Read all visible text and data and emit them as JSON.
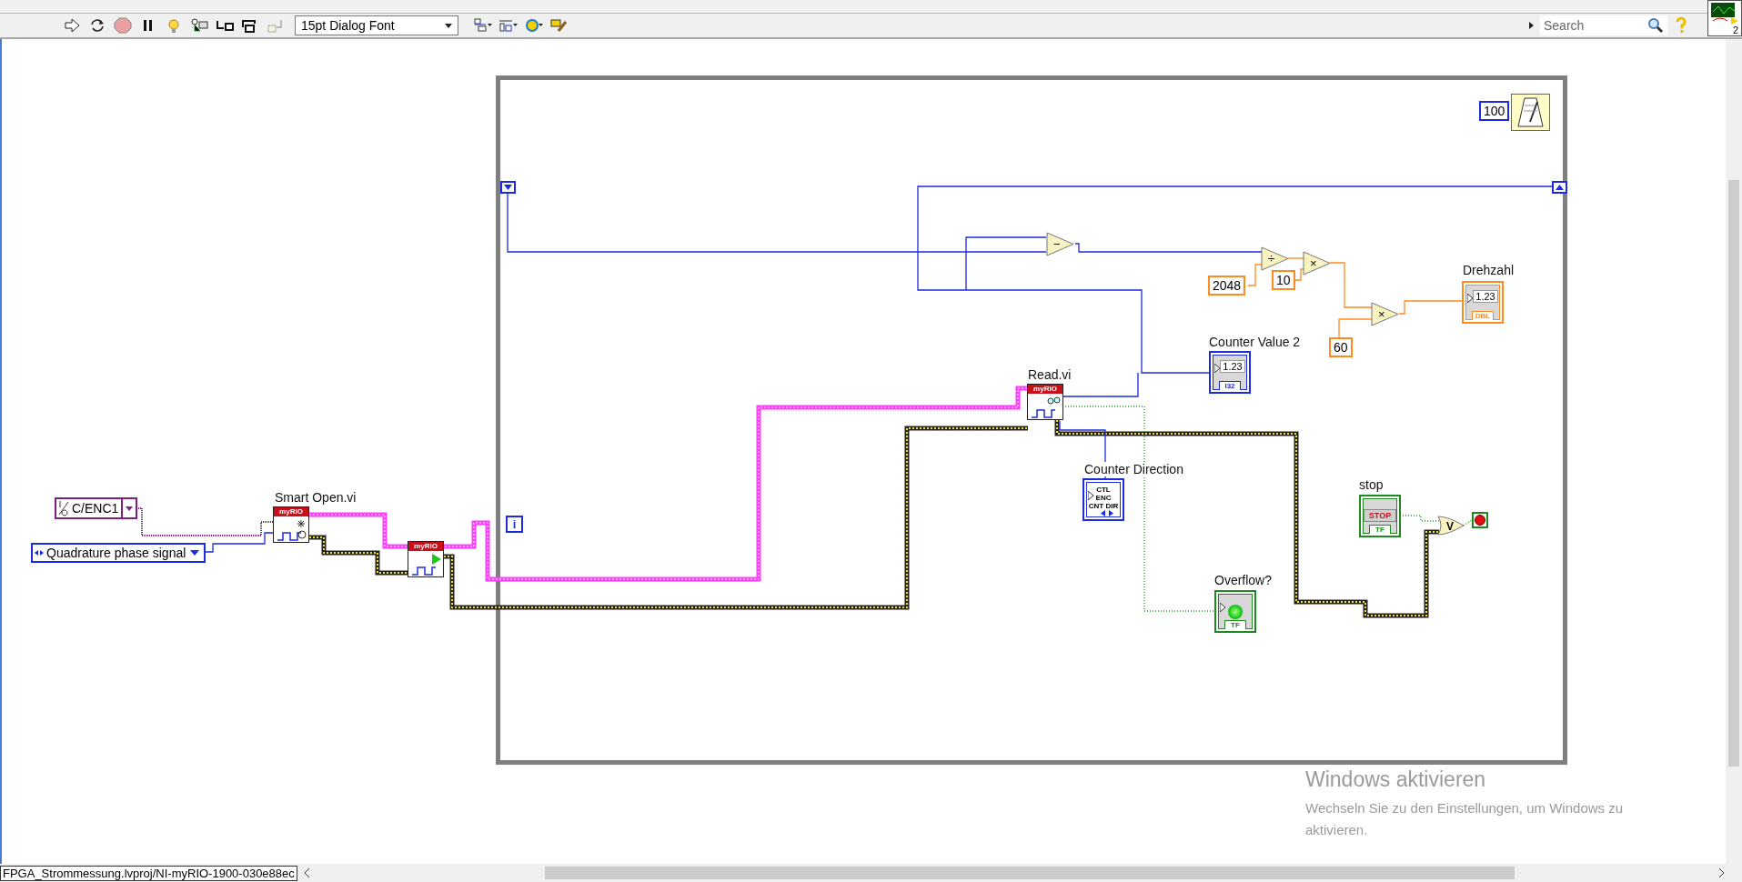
{
  "toolbar": {
    "font_menu": "15pt Dialog Font",
    "search": {
      "placeholder": "Search"
    }
  },
  "vi_icon": {
    "badge": "2"
  },
  "diagram": {
    "inputs": [
      {
        "kind": "io",
        "text": "C/ENC1"
      },
      {
        "kind": "ring",
        "text": "Quadrature phase signal"
      }
    ],
    "subvis": [
      {
        "label": "Smart Open.vi",
        "header": "myRIO",
        "kind": "open"
      },
      {
        "header": "myRIO",
        "kind": "start"
      },
      {
        "label": "Read.vi",
        "header": "myRIO",
        "kind": "read"
      }
    ],
    "while_loop": {
      "iteration": "i",
      "wait_ms": "100"
    },
    "operators": [
      {
        "kind": "subtract",
        "symbol": "−"
      },
      {
        "kind": "divide",
        "symbol": "÷"
      },
      {
        "kind": "multiply",
        "symbol": "×"
      },
      {
        "kind": "multiply",
        "symbol": "×"
      },
      {
        "kind": "or",
        "symbol": "V"
      }
    ],
    "constants": [
      "2048",
      "10",
      "60"
    ],
    "indicators": [
      {
        "kind": "numeric",
        "label": "Counter Value 2",
        "value": "1.23",
        "type": "I32",
        "color": "#1f2bd8"
      },
      {
        "kind": "numeric",
        "label": "Drehzahl",
        "value": "1.23",
        "type": "DBL",
        "color": "#ff8a1f"
      },
      {
        "kind": "enum",
        "label": "Counter Direction",
        "lines": [
          "CTL",
          "ENC",
          "CNT DIR"
        ]
      },
      {
        "kind": "led",
        "label": "Overflow?",
        "type": "TF",
        "on": true
      },
      {
        "kind": "button",
        "label": "stop",
        "text": "STOP",
        "type": "TF"
      }
    ]
  },
  "status_bar": {
    "path": "FPGA_Strommessung.lvproj/NI-myRIO-1900-030e88ec"
  },
  "activation_notice": {
    "title": "Windows aktivieren",
    "text": "Wechseln Sie zu den Einstellungen, um Windows zu aktivieren."
  }
}
